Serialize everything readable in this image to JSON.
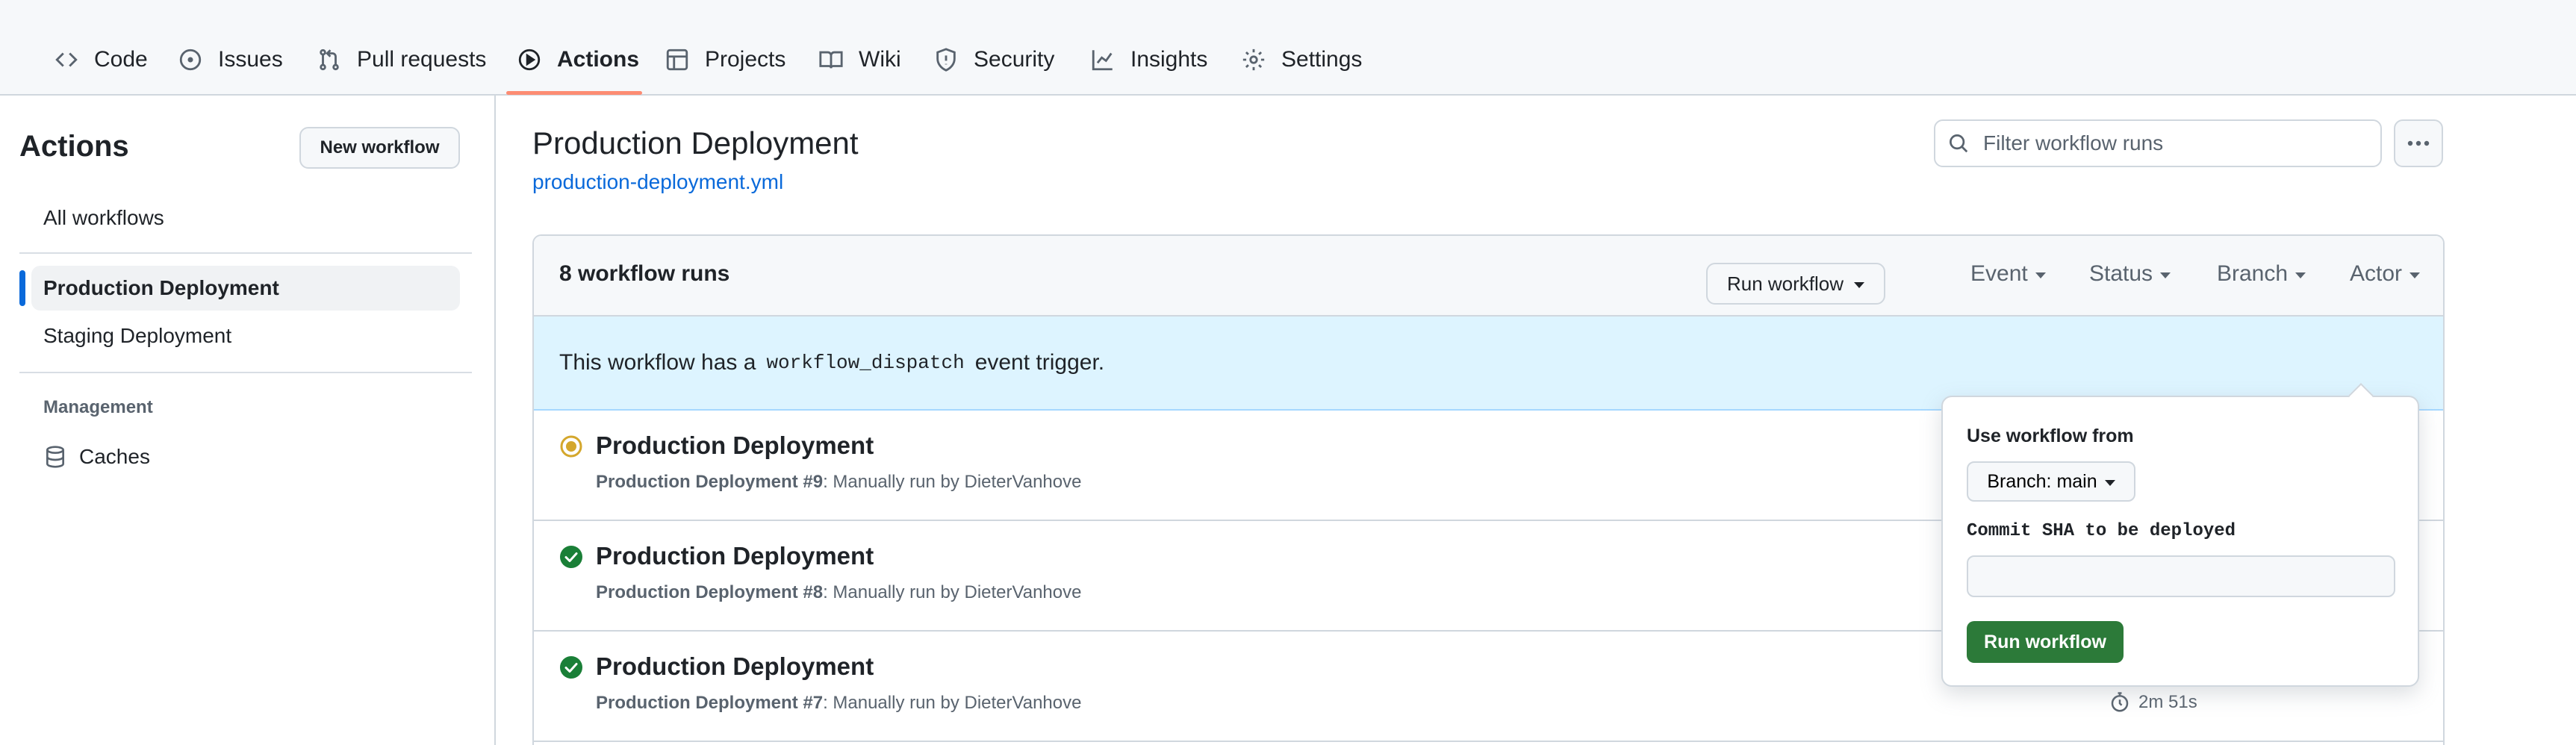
{
  "nav": {
    "tabs": [
      {
        "label": "Code",
        "icon": "code-icon"
      },
      {
        "label": "Issues",
        "icon": "issue-opened-icon"
      },
      {
        "label": "Pull requests",
        "icon": "git-pull-request-icon"
      },
      {
        "label": "Actions",
        "icon": "play-icon",
        "active": true
      },
      {
        "label": "Projects",
        "icon": "table-icon"
      },
      {
        "label": "Wiki",
        "icon": "book-icon"
      },
      {
        "label": "Security",
        "icon": "shield-icon"
      },
      {
        "label": "Insights",
        "icon": "graph-icon"
      },
      {
        "label": "Settings",
        "icon": "gear-icon"
      }
    ],
    "accent_color": "#fd8c73"
  },
  "sidebar": {
    "title": "Actions",
    "new_workflow_label": "New workflow",
    "all_workflows_label": "All workflows",
    "workflows": [
      {
        "label": "Production Deployment",
        "active": true
      },
      {
        "label": "Staging Deployment"
      }
    ],
    "management_heading": "Management",
    "caches_label": "Caches"
  },
  "main": {
    "workflow_title": "Production Deployment",
    "workflow_file": "production-deployment.yml",
    "filter_placeholder": "Filter workflow runs",
    "runs_count": "8 workflow runs",
    "filters": [
      "Event",
      "Status",
      "Branch",
      "Actor"
    ],
    "dispatch": {
      "prefix": "This workflow has a",
      "code": "workflow_dispatch",
      "suffix": "event trigger.",
      "run_button_label": "Run workflow"
    },
    "runs": [
      {
        "title": "Production Deployment",
        "workflow": "Production Deployment",
        "number": " #9",
        "detail": ": Manually run by DieterVanhove",
        "status": "in-progress"
      },
      {
        "title": "Production Deployment",
        "workflow": "Production Deployment",
        "number": " #8",
        "detail": ": Manually run by DieterVanhove",
        "status": "success"
      },
      {
        "title": "Production Deployment",
        "workflow": "Production Deployment",
        "number": " #7",
        "detail": ": Manually run by DieterVanhove",
        "status": "success"
      }
    ],
    "last_visible_duration": "2m 51s"
  },
  "popover": {
    "use_from_label": "Use workflow from",
    "branch_label": "Branch: main",
    "sha_label": "Commit SHA to be deployed",
    "sha_value": "",
    "submit_label": "Run workflow",
    "submit_color": "#2c7a39"
  },
  "colors": {
    "link": "#0969da",
    "success": "#1a7f37",
    "in_progress": "#d4a72c",
    "dispatch_bg": "#ddf4ff"
  }
}
